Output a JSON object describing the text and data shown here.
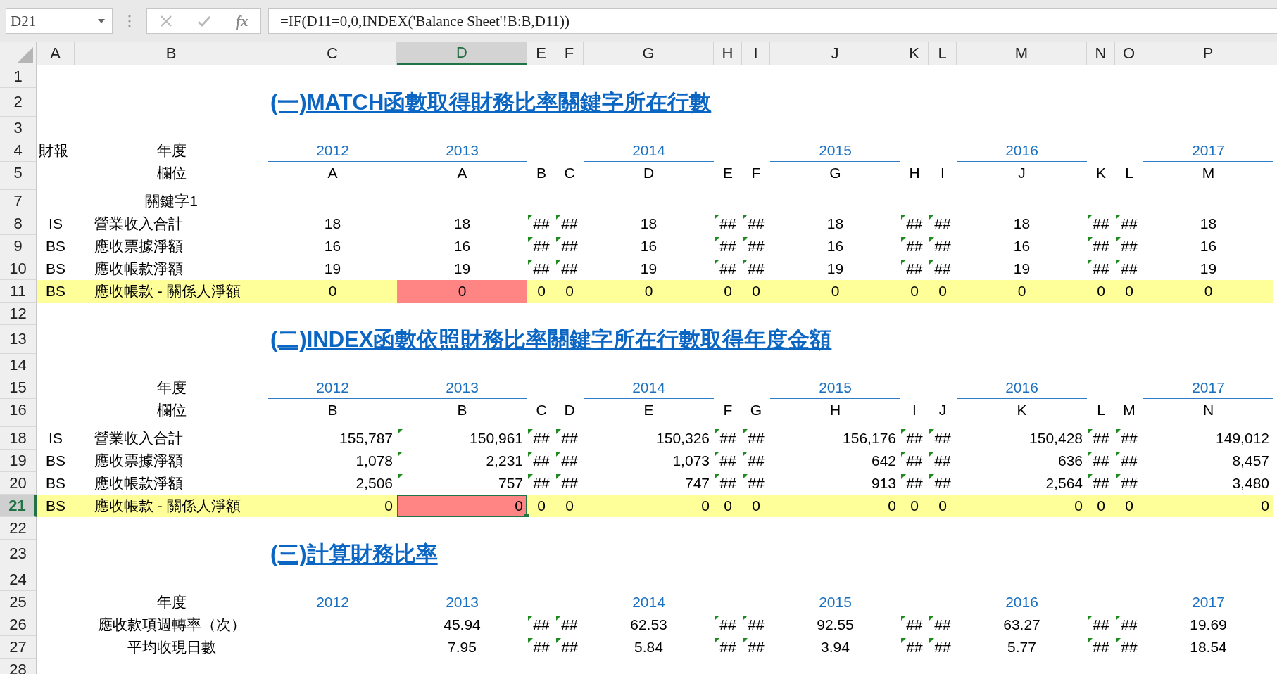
{
  "formula_bar": {
    "name_box": "D21",
    "fx_label": "fx",
    "formula": "=IF(D11=0,0,INDEX('Balance Sheet'!B:B,D11))"
  },
  "sheet": {
    "columns": [
      {
        "label": "A",
        "selected": false
      },
      {
        "label": "B",
        "selected": false
      },
      {
        "label": "C",
        "selected": false
      },
      {
        "label": "D",
        "selected": true
      },
      {
        "label": "E",
        "selected": false
      },
      {
        "label": "F",
        "selected": false
      },
      {
        "label": "G",
        "selected": false
      },
      {
        "label": "H",
        "selected": false
      },
      {
        "label": "I",
        "selected": false
      },
      {
        "label": "J",
        "selected": false
      },
      {
        "label": "K",
        "selected": false
      },
      {
        "label": "L",
        "selected": false
      },
      {
        "label": "M",
        "selected": false
      },
      {
        "label": "N",
        "selected": false
      },
      {
        "label": "O",
        "selected": false
      },
      {
        "label": "P",
        "selected": false
      }
    ],
    "rows": [
      {
        "number": "1",
        "kind": "blank",
        "selected": false
      },
      {
        "number": "2",
        "kind": "title",
        "selected": false,
        "cells": {
          "C": {
            "text": "(一)MATCH函數取得財務比率關鍵字所在行數"
          }
        }
      },
      {
        "number": "3",
        "kind": "blank",
        "selected": false
      },
      {
        "number": "4",
        "kind": "years",
        "selected": false,
        "cells": {
          "A": {
            "text": "財報"
          },
          "B": {
            "text": "年度"
          },
          "C": {
            "text": "2012"
          },
          "D": {
            "text": "2013"
          },
          "G": {
            "text": "2014"
          },
          "J": {
            "text": "2015"
          },
          "M": {
            "text": "2016"
          },
          "P": {
            "text": "2017"
          }
        }
      },
      {
        "number": "5",
        "kind": "fields",
        "selected": false,
        "cells": {
          "B": {
            "text": "欄位"
          },
          "C": {
            "text": "A"
          },
          "D": {
            "text": "A"
          },
          "E": {
            "text": "B"
          },
          "F": {
            "text": "C"
          },
          "G": {
            "text": "D"
          },
          "H": {
            "text": "E"
          },
          "I": {
            "text": "F"
          },
          "J": {
            "text": "G"
          },
          "K": {
            "text": "H"
          },
          "L": {
            "text": "I"
          },
          "M": {
            "text": "J"
          },
          "N": {
            "text": "K"
          },
          "O": {
            "text": "L"
          },
          "P": {
            "text": "M"
          }
        }
      },
      {
        "kind": "spacer",
        "selected": false
      },
      {
        "number": "7",
        "kind": "keyword",
        "selected": false,
        "cells": {
          "B": {
            "text": "關鍵字1"
          }
        }
      },
      {
        "number": "8",
        "kind": "lookup",
        "selected": false,
        "cells": {
          "A": {
            "text": "IS"
          },
          "B": {
            "text": "營業收入合計"
          },
          "C": {
            "text": "18"
          },
          "D": {
            "text": "18"
          },
          "E": {
            "text": "##",
            "flagged": true
          },
          "F": {
            "text": "##",
            "flagged": true
          },
          "G": {
            "text": "18"
          },
          "H": {
            "text": "##",
            "flagged": true
          },
          "I": {
            "text": "##",
            "flagged": true
          },
          "J": {
            "text": "18"
          },
          "K": {
            "text": "##",
            "flagged": true
          },
          "L": {
            "text": "##",
            "flagged": true
          },
          "M": {
            "text": "18"
          },
          "N": {
            "text": "##",
            "flagged": true
          },
          "O": {
            "text": "##",
            "flagged": true
          },
          "P": {
            "text": "18"
          }
        }
      },
      {
        "number": "9",
        "kind": "lookup",
        "selected": false,
        "cells": {
          "A": {
            "text": "BS"
          },
          "B": {
            "text": "應收票據淨額"
          },
          "C": {
            "text": "16"
          },
          "D": {
            "text": "16"
          },
          "E": {
            "text": "##",
            "flagged": true
          },
          "F": {
            "text": "##",
            "flagged": true
          },
          "G": {
            "text": "16"
          },
          "H": {
            "text": "##",
            "flagged": true
          },
          "I": {
            "text": "##",
            "flagged": true
          },
          "J": {
            "text": "16"
          },
          "K": {
            "text": "##",
            "flagged": true
          },
          "L": {
            "text": "##",
            "flagged": true
          },
          "M": {
            "text": "16"
          },
          "N": {
            "text": "##",
            "flagged": true
          },
          "O": {
            "text": "##",
            "flagged": true
          },
          "P": {
            "text": "16"
          }
        }
      },
      {
        "number": "10",
        "kind": "lookup",
        "selected": false,
        "cells": {
          "A": {
            "text": "BS"
          },
          "B": {
            "text": "應收帳款淨額"
          },
          "C": {
            "text": "19"
          },
          "D": {
            "text": "19"
          },
          "E": {
            "text": "##",
            "flagged": true
          },
          "F": {
            "text": "##",
            "flagged": true
          },
          "G": {
            "text": "19"
          },
          "H": {
            "text": "##",
            "flagged": true
          },
          "I": {
            "text": "##",
            "flagged": true
          },
          "J": {
            "text": "19"
          },
          "K": {
            "text": "##",
            "flagged": true
          },
          "L": {
            "text": "##",
            "flagged": true
          },
          "M": {
            "text": "19"
          },
          "N": {
            "text": "##",
            "flagged": true
          },
          "O": {
            "text": "##",
            "flagged": true
          },
          "P": {
            "text": "19"
          }
        }
      },
      {
        "number": "11",
        "kind": "lookup",
        "selected": false,
        "highlighted": true,
        "cells": {
          "A": {
            "text": "BS"
          },
          "B": {
            "text": "應收帳款 - 關係人淨額"
          },
          "C": {
            "text": "0"
          },
          "D": {
            "text": "0",
            "alert": true
          },
          "E": {
            "text": "0"
          },
          "F": {
            "text": "0"
          },
          "G": {
            "text": "0"
          },
          "H": {
            "text": "0"
          },
          "I": {
            "text": "0"
          },
          "J": {
            "text": "0"
          },
          "K": {
            "text": "0"
          },
          "L": {
            "text": "0"
          },
          "M": {
            "text": "0"
          },
          "N": {
            "text": "0"
          },
          "O": {
            "text": "0"
          },
          "P": {
            "text": "0"
          }
        }
      },
      {
        "number": "12",
        "kind": "blank",
        "selected": false
      },
      {
        "number": "13",
        "kind": "title",
        "selected": false,
        "cells": {
          "C": {
            "text": "(二)INDEX函數依照財務比率關鍵字所在行數取得年度金額"
          }
        }
      },
      {
        "number": "14",
        "kind": "blank",
        "selected": false
      },
      {
        "number": "15",
        "kind": "years",
        "selected": false,
        "cells": {
          "B": {
            "text": "年度"
          },
          "C": {
            "text": "2012"
          },
          "D": {
            "text": "2013"
          },
          "G": {
            "text": "2014"
          },
          "J": {
            "text": "2015"
          },
          "M": {
            "text": "2016"
          },
          "P": {
            "text": "2017"
          }
        }
      },
      {
        "number": "16",
        "kind": "fields",
        "selected": false,
        "cells": {
          "B": {
            "text": "欄位"
          },
          "C": {
            "text": "B"
          },
          "D": {
            "text": "B"
          },
          "E": {
            "text": "C"
          },
          "F": {
            "text": "D"
          },
          "G": {
            "text": "E"
          },
          "H": {
            "text": "F"
          },
          "I": {
            "text": "G"
          },
          "J": {
            "text": "H"
          },
          "K": {
            "text": "I"
          },
          "L": {
            "text": "J"
          },
          "M": {
            "text": "K"
          },
          "N": {
            "text": "L"
          },
          "O": {
            "text": "M"
          },
          "P": {
            "text": "N"
          }
        }
      },
      {
        "kind": "spacer",
        "selected": false
      },
      {
        "number": "18",
        "kind": "amounts",
        "selected": false,
        "cells": {
          "A": {
            "text": "IS"
          },
          "B": {
            "text": "營業收入合計"
          },
          "C": {
            "text": "155,787"
          },
          "D": {
            "text": "150,961",
            "flagged": true
          },
          "E": {
            "text": "##",
            "flagged": true
          },
          "F": {
            "text": "##",
            "flagged": true
          },
          "G": {
            "text": "150,326"
          },
          "H": {
            "text": "##",
            "flagged": true
          },
          "I": {
            "text": "##",
            "flagged": true
          },
          "J": {
            "text": "156,176"
          },
          "K": {
            "text": "##",
            "flagged": true
          },
          "L": {
            "text": "##",
            "flagged": true
          },
          "M": {
            "text": "150,428"
          },
          "N": {
            "text": "##",
            "flagged": true
          },
          "O": {
            "text": "##",
            "flagged": true
          },
          "P": {
            "text": "149,012"
          }
        }
      },
      {
        "number": "19",
        "kind": "amounts",
        "selected": false,
        "cells": {
          "A": {
            "text": "BS"
          },
          "B": {
            "text": "應收票據淨額"
          },
          "C": {
            "text": "1,078"
          },
          "D": {
            "text": "2,231",
            "flagged": true
          },
          "E": {
            "text": "##",
            "flagged": true
          },
          "F": {
            "text": "##",
            "flagged": true
          },
          "G": {
            "text": "1,073"
          },
          "H": {
            "text": "##",
            "flagged": true
          },
          "I": {
            "text": "##",
            "flagged": true
          },
          "J": {
            "text": "642"
          },
          "K": {
            "text": "##",
            "flagged": true
          },
          "L": {
            "text": "##",
            "flagged": true
          },
          "M": {
            "text": "636"
          },
          "N": {
            "text": "##",
            "flagged": true
          },
          "O": {
            "text": "##",
            "flagged": true
          },
          "P": {
            "text": "8,457"
          }
        }
      },
      {
        "number": "20",
        "kind": "amounts",
        "selected": false,
        "cells": {
          "A": {
            "text": "BS"
          },
          "B": {
            "text": "應收帳款淨額"
          },
          "C": {
            "text": "2,506"
          },
          "D": {
            "text": "757",
            "flagged": true
          },
          "E": {
            "text": "##",
            "flagged": true
          },
          "F": {
            "text": "##",
            "flagged": true
          },
          "G": {
            "text": "747"
          },
          "H": {
            "text": "##",
            "flagged": true
          },
          "I": {
            "text": "##",
            "flagged": true
          },
          "J": {
            "text": "913"
          },
          "K": {
            "text": "##",
            "flagged": true
          },
          "L": {
            "text": "##",
            "flagged": true
          },
          "M": {
            "text": "2,564"
          },
          "N": {
            "text": "##",
            "flagged": true
          },
          "O": {
            "text": "##",
            "flagged": true
          },
          "P": {
            "text": "3,480"
          }
        }
      },
      {
        "number": "21",
        "kind": "amounts",
        "selected": true,
        "highlighted": true,
        "cells": {
          "A": {
            "text": "BS"
          },
          "B": {
            "text": "應收帳款 - 關係人淨額"
          },
          "C": {
            "text": "0"
          },
          "D": {
            "text": "0",
            "alert": true
          },
          "E": {
            "text": "0"
          },
          "F": {
            "text": "0"
          },
          "G": {
            "text": "0"
          },
          "H": {
            "text": "0"
          },
          "I": {
            "text": "0"
          },
          "J": {
            "text": "0"
          },
          "K": {
            "text": "0"
          },
          "L": {
            "text": "0"
          },
          "M": {
            "text": "0"
          },
          "N": {
            "text": "0"
          },
          "O": {
            "text": "0"
          },
          "P": {
            "text": "0"
          }
        }
      },
      {
        "number": "22",
        "kind": "blank",
        "selected": false
      },
      {
        "number": "23",
        "kind": "title",
        "selected": false,
        "cells": {
          "C": {
            "text": "(三)計算財務比率"
          }
        }
      },
      {
        "number": "24",
        "kind": "blank",
        "selected": false
      },
      {
        "number": "25",
        "kind": "years",
        "selected": false,
        "cells": {
          "B": {
            "text": "年度"
          },
          "C": {
            "text": "2012"
          },
          "D": {
            "text": "2013"
          },
          "G": {
            "text": "2014"
          },
          "J": {
            "text": "2015"
          },
          "M": {
            "text": "2016"
          },
          "P": {
            "text": "2017"
          }
        }
      },
      {
        "number": "26",
        "kind": "ratio",
        "selected": false,
        "cells": {
          "B": {
            "text": "應收款項週轉率（次）"
          },
          "D": {
            "text": "45.94"
          },
          "E": {
            "text": "##",
            "flagged": true
          },
          "F": {
            "text": "##",
            "flagged": true
          },
          "G": {
            "text": "62.53"
          },
          "H": {
            "text": "##",
            "flagged": true
          },
          "I": {
            "text": "##",
            "flagged": true
          },
          "J": {
            "text": "92.55"
          },
          "K": {
            "text": "##",
            "flagged": true
          },
          "L": {
            "text": "##",
            "flagged": true
          },
          "M": {
            "text": "63.27"
          },
          "N": {
            "text": "##",
            "flagged": true
          },
          "O": {
            "text": "##",
            "flagged": true
          },
          "P": {
            "text": "19.69"
          }
        }
      },
      {
        "number": "27",
        "kind": "ratio",
        "selected": false,
        "cells": {
          "B": {
            "text": "平均收現日數"
          },
          "D": {
            "text": "7.95"
          },
          "E": {
            "text": "##",
            "flagged": true
          },
          "F": {
            "text": "##",
            "flagged": true
          },
          "G": {
            "text": "5.84"
          },
          "H": {
            "text": "##",
            "flagged": true
          },
          "I": {
            "text": "##",
            "flagged": true
          },
          "J": {
            "text": "3.94"
          },
          "K": {
            "text": "##",
            "flagged": true
          },
          "L": {
            "text": "##",
            "flagged": true
          },
          "M": {
            "text": "5.77"
          },
          "N": {
            "text": "##",
            "flagged": true
          },
          "O": {
            "text": "##",
            "flagged": true
          },
          "P": {
            "text": "18.54"
          }
        }
      },
      {
        "number": "28",
        "kind": "blank",
        "selected": false
      }
    ]
  }
}
